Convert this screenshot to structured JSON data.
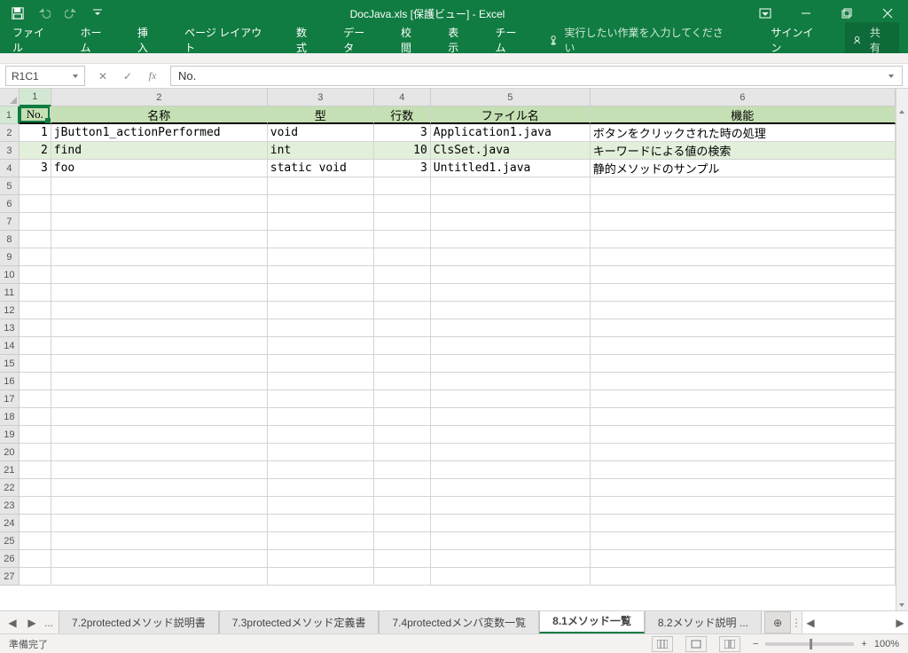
{
  "titlebar": {
    "title": "DocJava.xls  [保護ビュー] - Excel"
  },
  "ribbon": {
    "tabs": [
      "ファイル",
      "ホーム",
      "挿入",
      "ページ レイアウト",
      "数式",
      "データ",
      "校閲",
      "表示",
      "チーム"
    ],
    "tell_me": "実行したい作業を入力してください",
    "sign_in": "サインイン",
    "share": "共有"
  },
  "formula_bar": {
    "name_box": "R1C1",
    "formula": "No."
  },
  "columns": {
    "widths": [
      36,
      244,
      120,
      64,
      180,
      344
    ],
    "labels": [
      "1",
      "2",
      "3",
      "4",
      "5",
      "6"
    ]
  },
  "header_row": [
    "No.",
    "名称",
    "型",
    "行数",
    "ファイル名",
    "機能"
  ],
  "data_rows": [
    {
      "no": "1",
      "name": "jButton1_actionPerformed",
      "type": "void",
      "lines": "3",
      "file": "Application1.java",
      "func": "ボタンをクリックされた時の処理"
    },
    {
      "no": "2",
      "name": "find",
      "type": "int",
      "lines": "10",
      "file": "ClsSet.java",
      "func": "キーワードによる値の検索"
    },
    {
      "no": "3",
      "name": "foo",
      "type": "static void",
      "lines": "3",
      "file": "Untitled1.java",
      "func": "静的メソッドのサンプル"
    }
  ],
  "visible_row_count": 27,
  "sheet_tabs": {
    "tabs": [
      {
        "label": "7.2protectedメソッド説明書",
        "active": false
      },
      {
        "label": "7.3protectedメソッド定義書",
        "active": false
      },
      {
        "label": "7.4protectedメンバ変数一覧",
        "active": false
      },
      {
        "label": "8.1メソッド一覧",
        "active": true
      },
      {
        "label": "8.2メソッド説明 ...",
        "active": false
      }
    ]
  },
  "statusbar": {
    "ready": "準備完了",
    "zoom": "100%"
  },
  "selection": {
    "row": 1,
    "col": 1
  }
}
